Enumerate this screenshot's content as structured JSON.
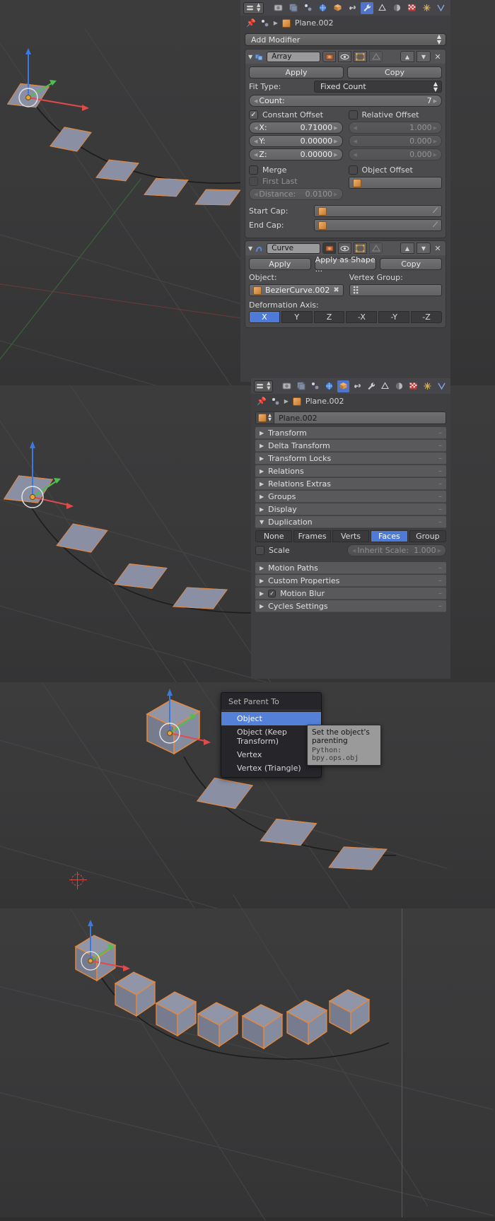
{
  "app": "Blender",
  "object_name": "Plane.002",
  "properties_editor_1": {
    "tabs": [
      "render-icon",
      "scene-icon",
      "world-icon-a",
      "world-icon",
      "object-cube-icon",
      "constraint-link-icon",
      "modifier-wrench-icon",
      "particles-icon",
      "physics-icon",
      "texture-checker-icon",
      "data-icon",
      "extra-icon"
    ],
    "active_tab": "modifier-wrench-icon",
    "breadcrumb": "Plane.002",
    "add_modifier_label": "Add Modifier",
    "modifiers": [
      {
        "name": "Array",
        "buttons": [
          "Apply",
          "Copy"
        ],
        "fit_type_label": "Fit Type:",
        "fit_type_value": "Fixed Count",
        "count_label": "Count:",
        "count_value": "7",
        "constant_offset_label": "Constant Offset",
        "constant_offset_checked": true,
        "relative_offset_label": "Relative Offset",
        "relative_offset_checked": false,
        "constant_values": [
          {
            "label": "X:",
            "value": "0.71000"
          },
          {
            "label": "Y:",
            "value": "0.00000"
          },
          {
            "label": "Z:",
            "value": "0.00000"
          }
        ],
        "relative_values": [
          {
            "label": "",
            "value": "1.000"
          },
          {
            "label": "",
            "value": "0.000"
          },
          {
            "label": "",
            "value": "0.000"
          }
        ],
        "merge_label": "Merge",
        "merge_checked": false,
        "first_last_label": "First Last",
        "first_last_checked": false,
        "distance_label": "Distance:",
        "distance_value": "0.0100",
        "object_offset_label": "Object Offset",
        "object_offset_checked": false,
        "start_cap_label": "Start Cap:",
        "start_cap_value": "",
        "end_cap_label": "End Cap:",
        "end_cap_value": ""
      },
      {
        "name": "Curve",
        "buttons": [
          "Apply",
          "Apply as Shape ...",
          "Copy"
        ],
        "object_label": "Object:",
        "object_value": "BezierCurve.002",
        "vertex_group_label": "Vertex Group:",
        "vertex_group_value": "",
        "deformation_axis_label": "Deformation Axis:",
        "axes": [
          "X",
          "Y",
          "Z",
          "-X",
          "-Y",
          "-Z"
        ],
        "active_axis": "X"
      }
    ]
  },
  "properties_editor_2": {
    "active_tab": "object-cube-icon",
    "breadcrumb": "Plane.002",
    "name_field_value": "Plane.002",
    "panels": [
      {
        "label": "Transform",
        "open": false
      },
      {
        "label": "Delta Transform",
        "open": false
      },
      {
        "label": "Transform Locks",
        "open": false
      },
      {
        "label": "Relations",
        "open": false
      },
      {
        "label": "Relations Extras",
        "open": false
      },
      {
        "label": "Groups",
        "open": false
      },
      {
        "label": "Display",
        "open": false
      },
      {
        "label": "Duplication",
        "open": true
      }
    ],
    "duplication": {
      "options": [
        "None",
        "Frames",
        "Verts",
        "Faces",
        "Group"
      ],
      "selected": "Faces",
      "scale_label": "Scale",
      "scale_checked": false,
      "inherit_scale_label": "Inherit Scale:",
      "inherit_scale_value": "1.000"
    },
    "panels_after": [
      {
        "label": "Motion Paths",
        "open": false
      },
      {
        "label": "Custom Properties",
        "open": false
      },
      {
        "label": "Motion Blur",
        "open": false,
        "checkbox": true
      },
      {
        "label": "Cycles Settings",
        "open": false
      }
    ]
  },
  "context_menu": {
    "title": "Set Parent To",
    "items": [
      {
        "label": "Object",
        "accel": "O",
        "selected": true
      },
      {
        "label": "Object (Keep Transform)",
        "accel": "K",
        "selected": false
      },
      {
        "label": "Vertex",
        "accel": "V",
        "selected": false
      },
      {
        "label": "Vertex (Triangle)",
        "accel": "T",
        "selected": false
      }
    ]
  },
  "tooltip": {
    "line1": "Set the object's parenting",
    "line2": "Python: bpy.ops.obj"
  }
}
